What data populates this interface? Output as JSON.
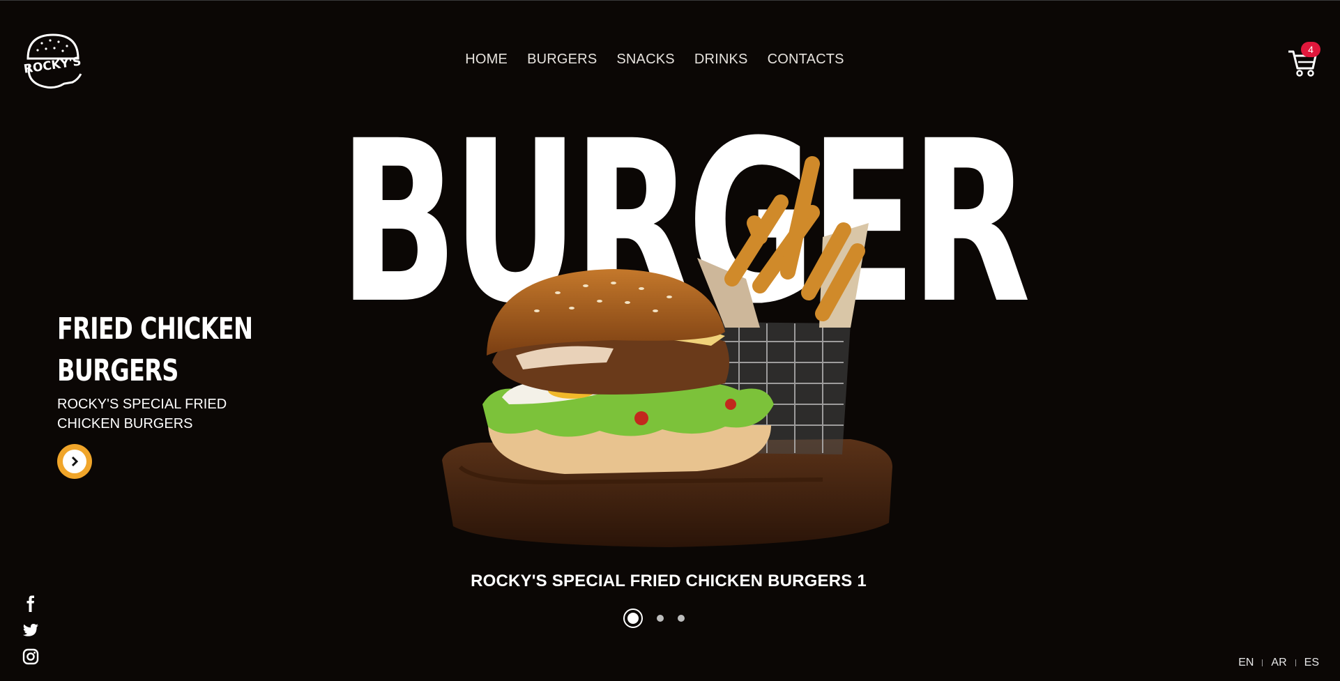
{
  "brand": {
    "logo_text": "ROCKY'S"
  },
  "nav": {
    "items": [
      "HOME",
      "BURGERS",
      "SNACKS",
      "DRINKS",
      "CONTACTS"
    ]
  },
  "cart": {
    "count": "4",
    "icon": "cart-icon",
    "badge_color": "#e0183c"
  },
  "hero": {
    "big_title": "BURGER",
    "side_title_line1": "FRIED CHICKEN",
    "side_title_line2": "BURGERS",
    "side_subtitle": "ROCKY'S SPECIAL FRIED CHICKEN BURGERS",
    "caption": "ROCKY'S SPECIAL FRIED CHICKEN BURGERS 1",
    "accent_color": "#f0a52a"
  },
  "slider": {
    "total": 3,
    "active": 1
  },
  "social": [
    "facebook-icon",
    "twitter-icon",
    "instagram-icon"
  ],
  "languages": [
    "EN",
    "AR",
    "ES"
  ],
  "colors": {
    "background": "#0b0705",
    "text": "#ffffff"
  }
}
